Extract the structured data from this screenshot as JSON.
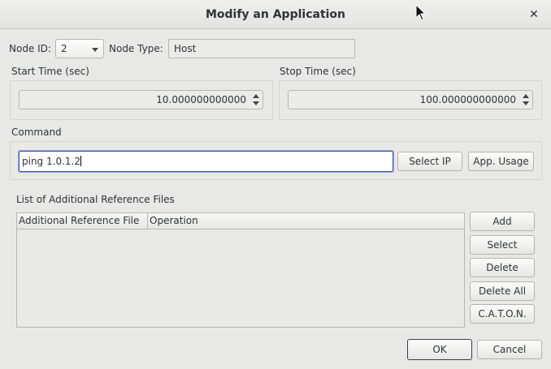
{
  "window": {
    "title": "Modify an Application"
  },
  "node": {
    "id_label": "Node ID:",
    "id_value": "2",
    "type_label": "Node Type:",
    "type_value": "Host"
  },
  "start_time": {
    "label": "Start Time (sec)",
    "value": "10.000000000000"
  },
  "stop_time": {
    "label": "Stop Time (sec)",
    "value": "100.000000000000"
  },
  "command": {
    "label": "Command",
    "value": "ping 1.0.1.2",
    "select_ip_label": "Select IP",
    "app_usage_label": "App. Usage"
  },
  "reference_files": {
    "label": "List of Additional Reference Files",
    "columns": [
      "Additional Reference File",
      "Operation"
    ],
    "rows": [],
    "buttons": [
      "Add",
      "Select",
      "Delete",
      "Delete All",
      "C.A.T.O.N."
    ]
  },
  "footer": {
    "ok_label": "OK",
    "cancel_label": "Cancel"
  },
  "icons": {
    "close": "close-icon",
    "cursor": "mouse-pointer-icon"
  }
}
